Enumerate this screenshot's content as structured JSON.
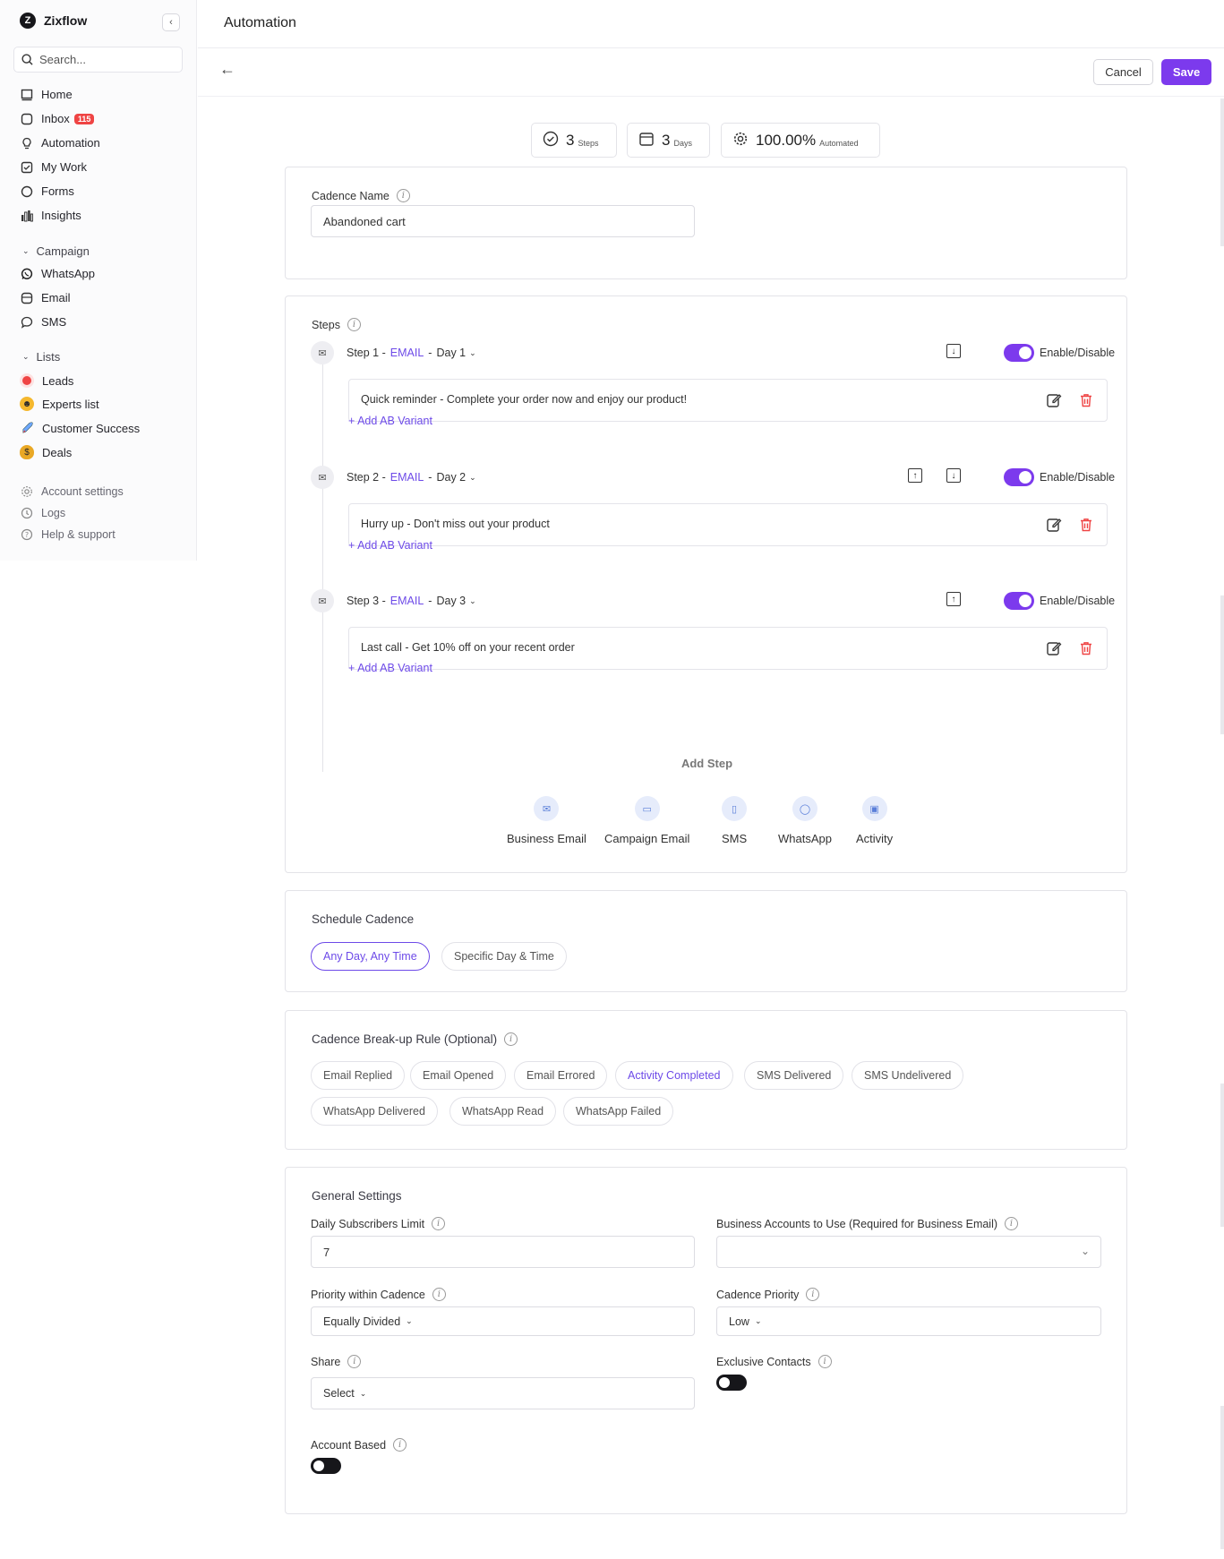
{
  "app": {
    "name": "Zixflow",
    "logo_letter": "Z"
  },
  "sidebar": {
    "search_placeholder": "Search...",
    "nav": [
      {
        "label": "Home",
        "icon": "home-icon"
      },
      {
        "label": "Inbox",
        "icon": "inbox-icon",
        "badge": "115"
      },
      {
        "label": "Automation",
        "icon": "automation-icon"
      },
      {
        "label": "My Work",
        "icon": "my-work-icon"
      },
      {
        "label": "Forms",
        "icon": "forms-icon"
      },
      {
        "label": "Insights",
        "icon": "insights-icon"
      }
    ],
    "campaign_section": "Campaign",
    "campaign": [
      {
        "label": "WhatsApp",
        "icon": "whatsapp-icon"
      },
      {
        "label": "Email",
        "icon": "email-icon"
      },
      {
        "label": "SMS",
        "icon": "sms-icon"
      }
    ],
    "lists_section": "Lists",
    "lists": [
      {
        "label": "Leads",
        "icon": "target-emoji-icon"
      },
      {
        "label": "Experts list",
        "icon": "face-emoji-icon"
      },
      {
        "label": "Customer Success",
        "icon": "rocket-emoji-icon"
      },
      {
        "label": "Deals",
        "icon": "money-bag-emoji-icon"
      }
    ],
    "footer": [
      {
        "label": "Account settings",
        "icon": "gear-icon"
      },
      {
        "label": "Logs",
        "icon": "logs-icon"
      },
      {
        "label": "Help & support",
        "icon": "help-icon"
      }
    ]
  },
  "header": {
    "title": "Automation",
    "cancel_label": "Cancel",
    "save_label": "Save"
  },
  "stats": [
    {
      "value": "3",
      "unit": "Steps",
      "icon": "check-circle-icon"
    },
    {
      "value": "3",
      "unit": "Days",
      "icon": "calendar-icon"
    },
    {
      "value": "100.00%",
      "unit": "Automated",
      "icon": "gear-icon"
    }
  ],
  "cadence": {
    "label": "Cadence Name",
    "value": "Abandoned cart"
  },
  "steps": {
    "title": "Steps",
    "items": [
      {
        "prefix": "Step 1 -",
        "channel": "EMAIL",
        "sep": "-",
        "day": "Day 1",
        "message": "Quick reminder - Complete your order now and enjoy our product!",
        "ab_label": "+ Add AB Variant",
        "toggle_label": "Enable/Disable",
        "enabled": true
      },
      {
        "prefix": "Step 2 -",
        "channel": "EMAIL",
        "sep": "-",
        "day": "Day 2",
        "message": "Hurry up - Don't miss out your product",
        "ab_label": "+ Add AB Variant",
        "toggle_label": "Enable/Disable",
        "enabled": true
      },
      {
        "prefix": "Step 3 -",
        "channel": "EMAIL",
        "sep": "-",
        "day": "Day 3",
        "message": "Last call - Get 10% off on your recent order",
        "ab_label": "+ Add AB Variant",
        "toggle_label": "Enable/Disable",
        "enabled": true
      }
    ],
    "add_step_title": "Add Step",
    "add_options": [
      {
        "label": "Business Email",
        "icon": "business-email-icon"
      },
      {
        "label": "Campaign Email",
        "icon": "campaign-email-icon"
      },
      {
        "label": "SMS",
        "icon": "sms-phone-icon"
      },
      {
        "label": "WhatsApp",
        "icon": "whatsapp-icon"
      },
      {
        "label": "Activity",
        "icon": "activity-calendar-icon"
      }
    ]
  },
  "schedule": {
    "title": "Schedule Cadence",
    "options": [
      "Any Day, Any Time",
      "Specific Day & Time"
    ],
    "selected": "Any Day, Any Time"
  },
  "breakup": {
    "title": "Cadence Break-up Rule (Optional)",
    "rules": [
      "Email Replied",
      "Email Opened",
      "Email Errored",
      "Activity Completed",
      "SMS Delivered",
      "SMS Undelivered",
      "WhatsApp Delivered",
      "WhatsApp Read",
      "WhatsApp Failed"
    ],
    "highlighted": "Activity Completed"
  },
  "general": {
    "title": "General Settings",
    "daily_limit_label": "Daily Subscribers Limit",
    "daily_limit_value": "7",
    "business_accounts_label": "Business Accounts to Use (Required for Business Email)",
    "business_accounts_value": "",
    "priority_label": "Priority within Cadence",
    "priority_value": "Equally Divided",
    "cadence_priority_label": "Cadence Priority",
    "cadence_priority_value": "Low",
    "share_label": "Share",
    "share_value": "Select",
    "exclusive_label": "Exclusive Contacts",
    "exclusive_enabled": false,
    "account_based_label": "Account Based",
    "account_based_enabled": false
  },
  "colors": {
    "accent": "#7c3aed",
    "link": "#6d4ae8",
    "danger": "#ef4444"
  }
}
